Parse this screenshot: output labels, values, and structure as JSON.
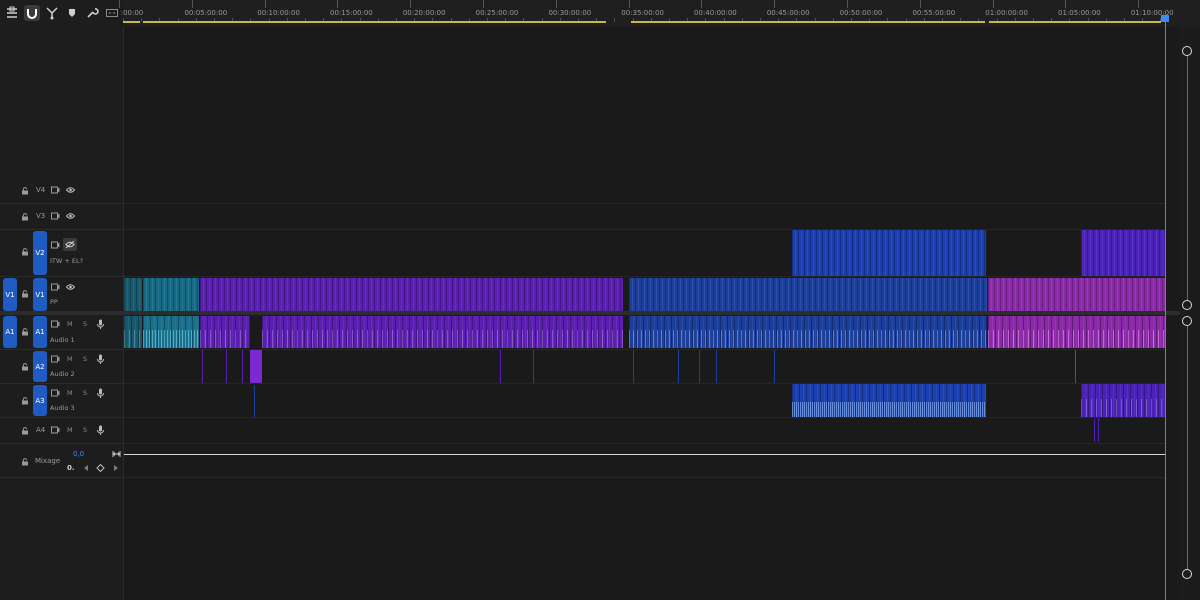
{
  "toolbar": {
    "tools": [
      {
        "name": "insert-nested-icon"
      },
      {
        "name": "snap-icon"
      },
      {
        "name": "linked-selection-icon"
      },
      {
        "name": "add-marker-icon"
      },
      {
        "name": "settings-wrench-icon"
      },
      {
        "name": "captions-icon"
      }
    ]
  },
  "ruler": {
    "labels": [
      ":00:00",
      "00:05:00:00",
      "00:10:00:00",
      "00:15:00:00",
      "00:20:00:00",
      "00:25:00:00",
      "00:30:00:00",
      "00:35:00:00",
      "00:40:00:00",
      "00:45:00:00",
      "00:50:00:00",
      "00:55:00:00",
      "01:00:00:00",
      "01:05:00:00",
      "01:10:00:00"
    ]
  },
  "tracks": {
    "v4": {
      "label": "V4"
    },
    "v3": {
      "label": "V3"
    },
    "v2": {
      "label": "V2",
      "name": "ITW + EL?"
    },
    "v1": {
      "label": "V1",
      "source": "V1",
      "name": "PP"
    },
    "a1": {
      "label": "A1",
      "source": "A1",
      "name": "Audio 1",
      "m": "M",
      "s": "S"
    },
    "a2": {
      "label": "A2",
      "name": "Audio 2",
      "m": "M",
      "s": "S"
    },
    "a3": {
      "label": "A3",
      "name": "Audio 3",
      "m": "M",
      "s": "S"
    },
    "a4": {
      "label": "A4",
      "m": "M",
      "s": "S"
    },
    "mix": {
      "label": "Mixage",
      "value": "0,0",
      "sub": "0."
    }
  },
  "colors": {
    "accent": "#1e5cc2",
    "playhead": "#3b8df5",
    "clip_teal": "#1a6a86",
    "clip_purple": "#6b1fbf",
    "clip_blue": "#1b3fa6",
    "clip_magenta": "#9a2db8"
  }
}
